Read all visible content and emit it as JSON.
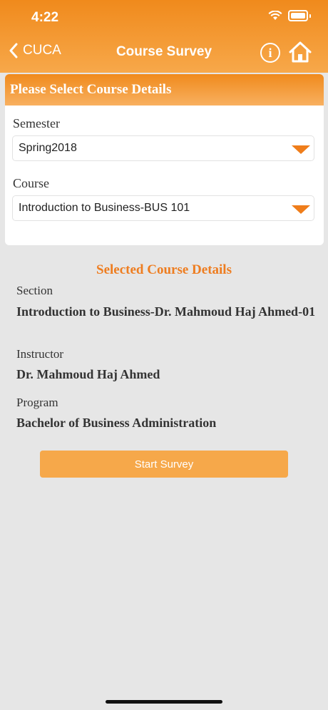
{
  "status_bar": {
    "time": "4:22"
  },
  "nav": {
    "back_label": "CUCA",
    "title": "Course Survey"
  },
  "form": {
    "header": "Please Select Course Details",
    "semester_label": "Semester",
    "semester_value": "Spring2018",
    "course_label": "Course",
    "course_value": "Introduction to Business-BUS 101"
  },
  "details": {
    "title": "Selected Course Details",
    "section_label": "Section",
    "section_value": "Introduction to Business-Dr. Mahmoud Haj Ahmed-01",
    "instructor_label": "Instructor",
    "instructor_value": "Dr. Mahmoud Haj Ahmed",
    "program_label": "Program",
    "program_value": "Bachelor of Business Administration"
  },
  "actions": {
    "start_survey": "Start Survey"
  },
  "colors": {
    "accent": "#f08a1c",
    "button": "#f6a84a",
    "accent_text": "#ee7d20"
  }
}
